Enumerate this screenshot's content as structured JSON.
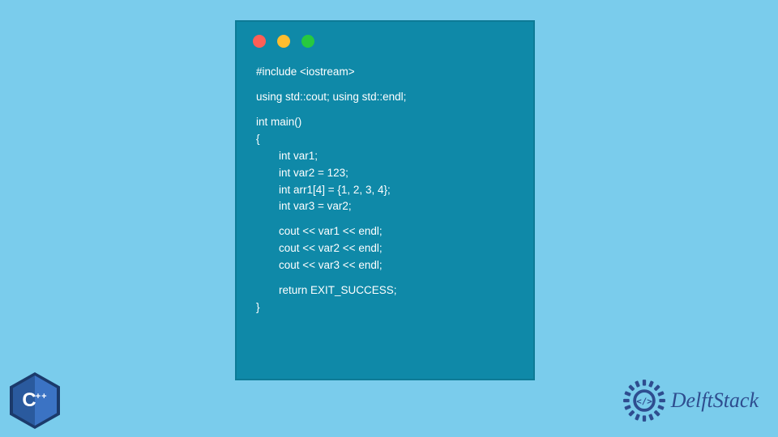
{
  "code": {
    "line1": "#include <iostream>",
    "line2": "using std::cout; using std::endl;",
    "line3": "int main()",
    "line4": "{",
    "line5": "int var1;",
    "line6": "int var2 = 123;",
    "line7": "int arr1[4] = {1, 2, 3, 4};",
    "line8": "int var3 = var2;",
    "line9": "cout << var1 << endl;",
    "line10": "cout << var2 << endl;",
    "line11": "cout << var3 << endl;",
    "line12": "return EXIT_SUCCESS;",
    "line13": "}"
  },
  "cpp_badge": {
    "letter": "C",
    "suffix": "++"
  },
  "brand": {
    "name": "DelftStack"
  }
}
